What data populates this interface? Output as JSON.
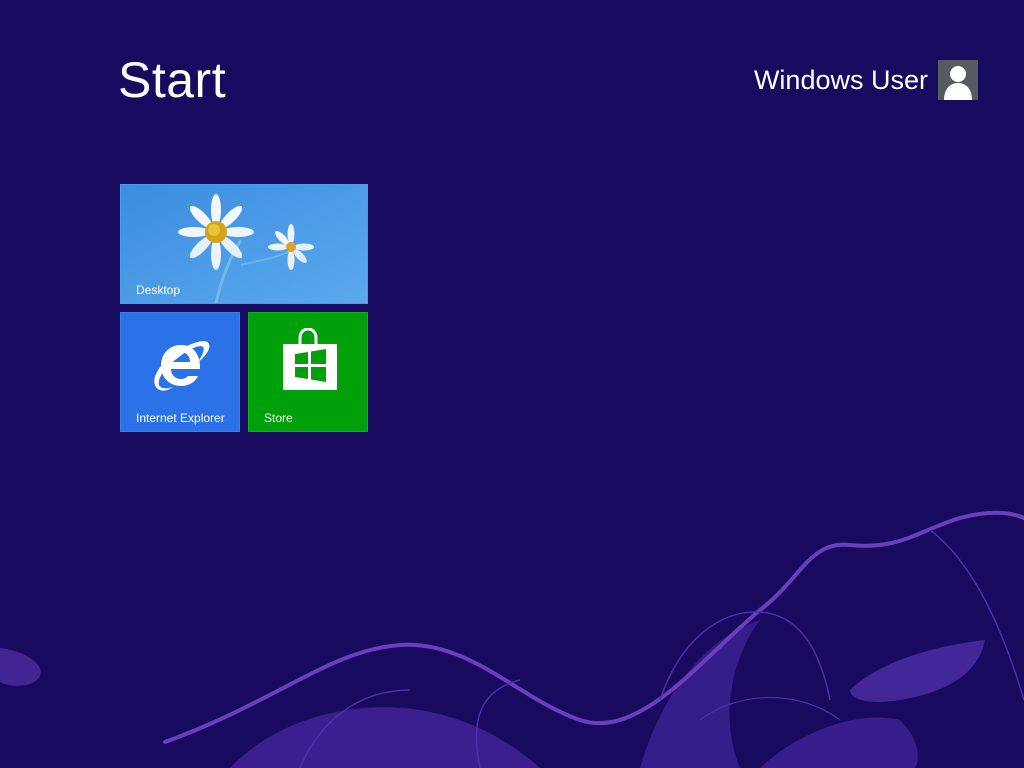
{
  "header": {
    "title": "Start",
    "user_name": "Windows User"
  },
  "icons": {
    "avatar": "user-avatar-icon",
    "desktop": "daisy-wallpaper-image",
    "internet_explorer": "internet-explorer-icon",
    "store": "store-bag-icon"
  },
  "tiles": [
    {
      "label": "Desktop",
      "color": "#3f8fe0"
    },
    {
      "label": "Internet Explorer",
      "color": "#2b72e8"
    },
    {
      "label": "Store",
      "color": "#00a00a"
    }
  ],
  "colors": {
    "background": "#180a5e",
    "decor": "#6a3fbf"
  }
}
